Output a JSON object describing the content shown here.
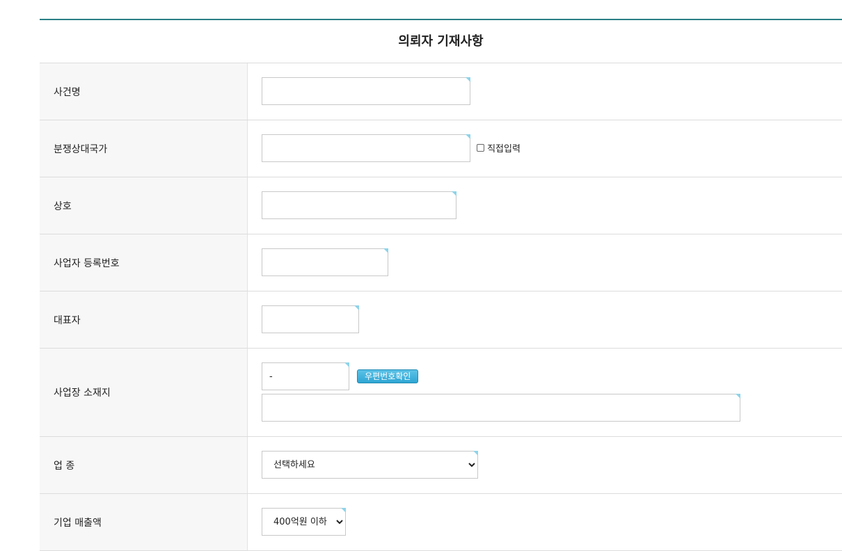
{
  "form": {
    "title": "의뢰자 기재사항",
    "rows": [
      {
        "label": "사건명",
        "value": ""
      },
      {
        "label": "분쟁상대국가",
        "value": "",
        "checkbox_label": "직접입력"
      },
      {
        "label": "상호",
        "value": ""
      },
      {
        "label": "사업자 등록번호",
        "value": ""
      },
      {
        "label": "대표자",
        "value": ""
      },
      {
        "label": "사업장 소재지",
        "zip_value": "-",
        "zip_button": "우편번호확인",
        "address_value": ""
      },
      {
        "label": "업 종",
        "selected": "선택하세요"
      },
      {
        "label": "기업 매출액",
        "selected": "400억원 이하"
      }
    ]
  },
  "colors": {
    "title_border": "#2a7f86",
    "label_bg": "#f7f7f7",
    "button_bg": "#3bb0dc",
    "input_corner": "#8fd3e8"
  }
}
